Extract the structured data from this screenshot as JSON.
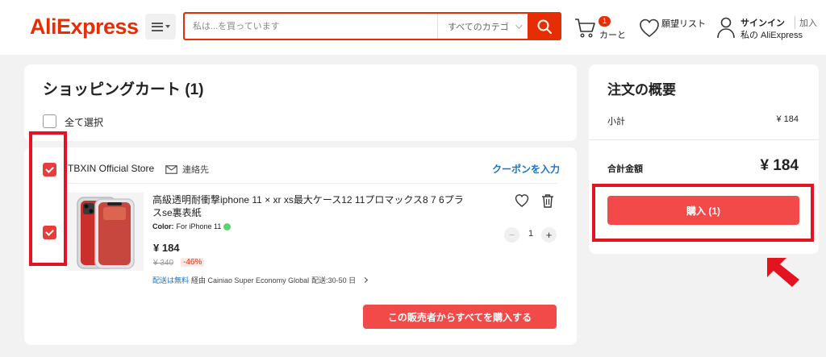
{
  "header": {
    "logo": "AliExpress",
    "search": {
      "placeholder": "私は...を買っています",
      "category": "すべてのカテゴ"
    },
    "cart": {
      "count": "1",
      "label": "カーと"
    },
    "wishlist_label": "願望リスト",
    "signin": "サインイン",
    "join": "加入",
    "my_account": "私の AliExpress"
  },
  "cart": {
    "title": "ショッピングカート (1)",
    "select_all": "全て選択",
    "store": {
      "name": "TBXIN Official Store",
      "contact": "連絡先",
      "coupon": "クーポンを入力",
      "buy_all": "この販売者からすべてを購入する"
    },
    "item": {
      "title": "高級透明耐衝撃iphone 11 × xr xs最大ケース12 11プロマックス8 7 6プラスse裏表紙",
      "color_label": "Color:",
      "color_value": "For iPhone 11",
      "price": "¥ 184",
      "old_price": "¥ 340",
      "discount": "-46%",
      "shipping_free": "配送は無料",
      "shipping_via": "経由 Cainiao Super Economy Global",
      "shipping_time": "配送:30-50 日",
      "quantity": "1",
      "checked": true
    }
  },
  "summary": {
    "title": "注文の概要",
    "subtotal_label": "小計",
    "subtotal": "¥ 184",
    "total_label": "合計金額",
    "total": "¥ 184",
    "buy_label": "購入 (1)"
  },
  "colors": {
    "brand": "#e62e04",
    "button": "#f24a48",
    "highlight": "#e3141f",
    "link": "#1a73c9"
  }
}
